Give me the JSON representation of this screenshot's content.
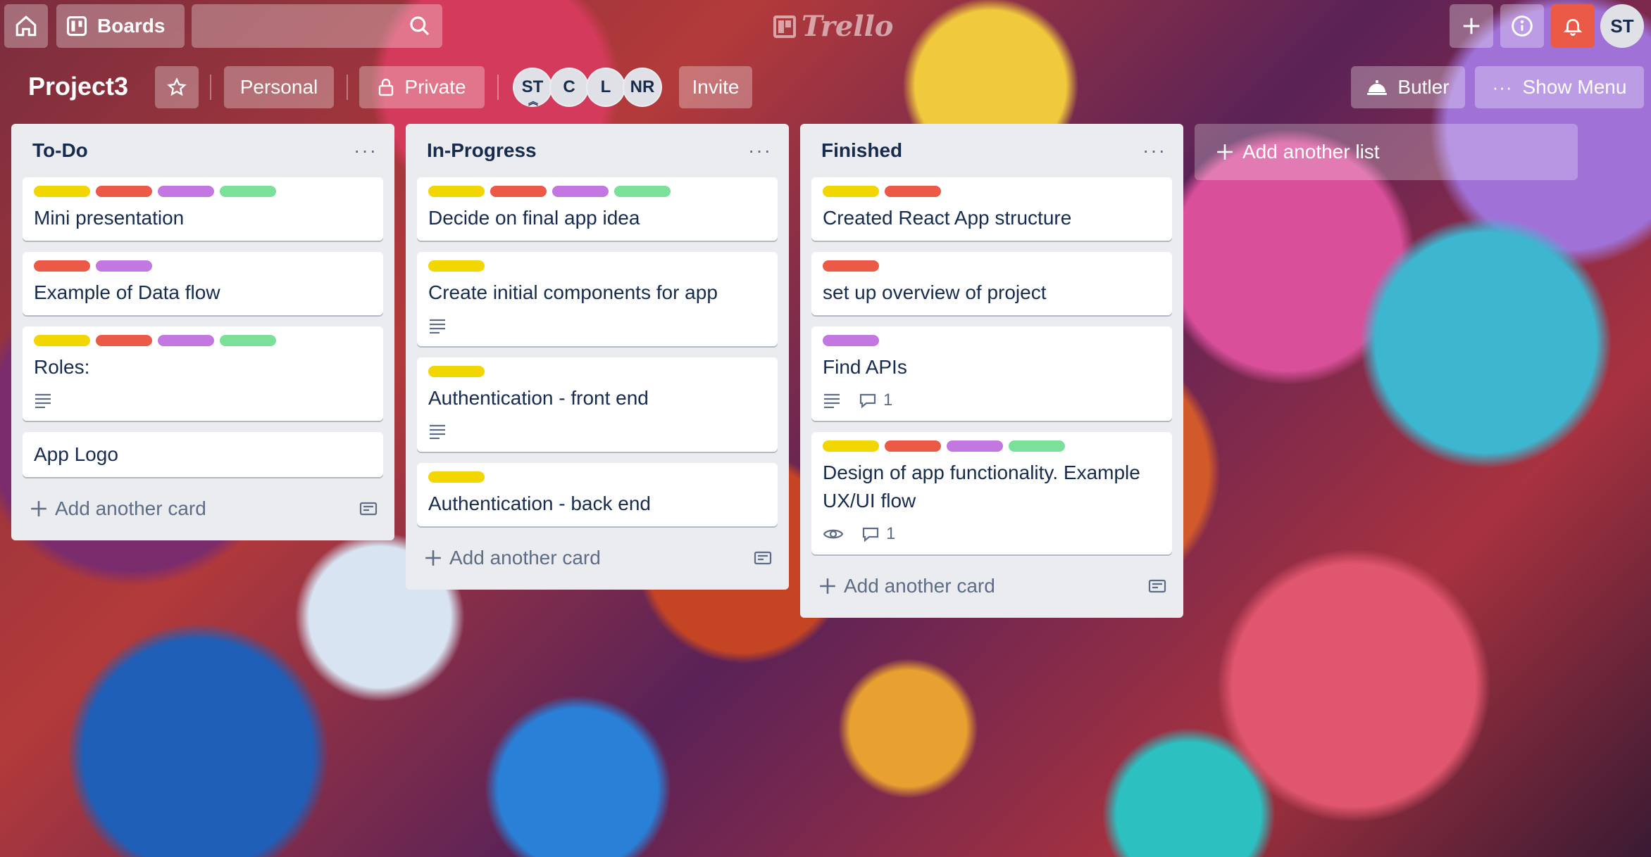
{
  "topbar": {
    "boards_label": "Boards",
    "logo_text": "Trello",
    "avatar_initials": "ST",
    "notification_color": "#eb5a46"
  },
  "board": {
    "title": "Project3",
    "team_label": "Personal",
    "visibility_label": "Private",
    "members": [
      "ST",
      "C",
      "L",
      "NR"
    ],
    "invite_label": "Invite",
    "butler_label": "Butler",
    "menu_label": "Show Menu"
  },
  "lists": [
    {
      "title": "To-Do",
      "add_card_label": "Add another card",
      "cards": [
        {
          "title": "Mini presentation",
          "labels": [
            "yellow",
            "red",
            "purple",
            "green"
          ]
        },
        {
          "title": "Example of Data flow",
          "labels": [
            "red",
            "purple"
          ]
        },
        {
          "title": "Roles:",
          "labels": [
            "yellow",
            "red",
            "purple",
            "green"
          ],
          "has_description": true
        },
        {
          "title": "App Logo",
          "labels": []
        }
      ]
    },
    {
      "title": "In-Progress",
      "add_card_label": "Add another card",
      "cards": [
        {
          "title": "Decide on final app idea",
          "labels": [
            "yellow",
            "red",
            "purple",
            "green"
          ]
        },
        {
          "title": "Create initial components for app",
          "labels": [
            "yellow"
          ],
          "has_description": true
        },
        {
          "title": "Authentication - front end",
          "labels": [
            "yellow"
          ],
          "has_description": true
        },
        {
          "title": "Authentication - back end",
          "labels": [
            "yellow"
          ]
        }
      ]
    },
    {
      "title": "Finished",
      "add_card_label": "Add another card",
      "cards": [
        {
          "title": "Created React App structure",
          "labels": [
            "yellow",
            "red"
          ]
        },
        {
          "title": "set up overview of project",
          "labels": [
            "red"
          ]
        },
        {
          "title": "Find APIs",
          "labels": [
            "purple"
          ],
          "has_description": true,
          "comments": "1"
        },
        {
          "title": "Design of app functionality. Example UX/UI flow",
          "labels": [
            "yellow",
            "red",
            "purple",
            "green"
          ],
          "watching": true,
          "comments": "1"
        }
      ]
    }
  ],
  "add_list_label": "Add another list",
  "label_colors": {
    "yellow": "#f2d600",
    "red": "#eb5a46",
    "purple": "#c377e0",
    "green": "#7be09a"
  }
}
